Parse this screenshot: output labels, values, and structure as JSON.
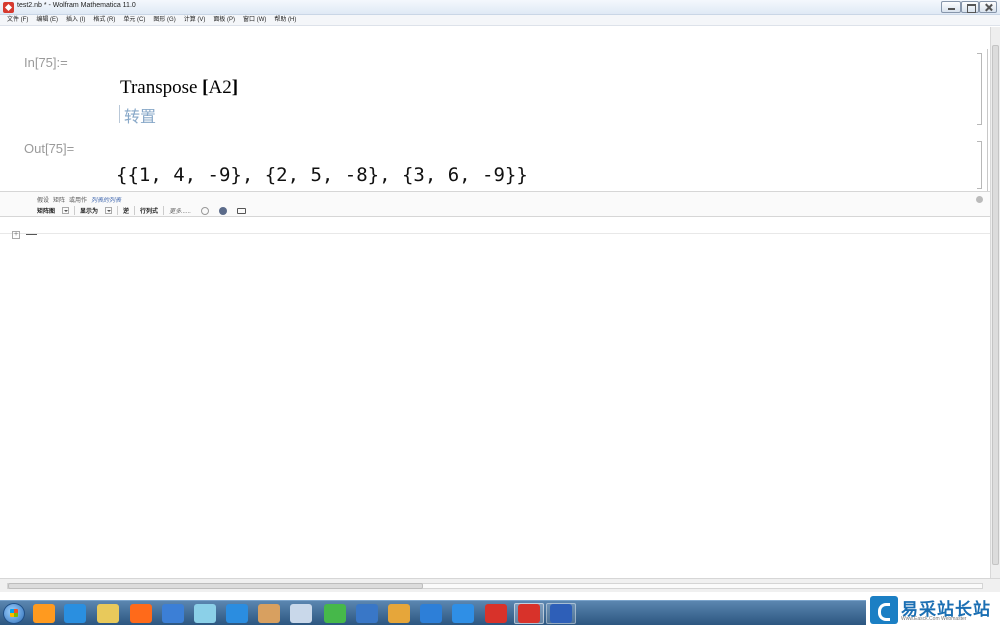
{
  "window": {
    "title": "test2.nb * - Wolfram Mathematica 11.0"
  },
  "menu": {
    "items": [
      {
        "label": "文件 (F)"
      },
      {
        "label": "编辑 (E)"
      },
      {
        "label": "插入 (I)"
      },
      {
        "label": "格式 (R)"
      },
      {
        "label": "单元 (C)"
      },
      {
        "label": "图形 (G)"
      },
      {
        "label": "计算 (V)"
      },
      {
        "label": "面板 (P)"
      },
      {
        "label": "窗口 (W)"
      },
      {
        "label": "帮助 (H)"
      }
    ]
  },
  "notebook": {
    "in_label": "In[75]:=",
    "input_fn": "Transpose ",
    "input_open": "[",
    "input_arg": "A2",
    "input_close": "]",
    "input_hint": "转置",
    "out_label": "Out[75]=",
    "output": "{{1, 4, -9}, {2, 5, -8}, {3, 6, -9}}"
  },
  "suggestions": {
    "row1": {
      "preset": "假设",
      "matrix": "矩阵",
      "or": "或用作",
      "list_of_lists": "列表的列表"
    },
    "row2": {
      "matrix_plot": "矩阵图",
      "display_as": "显示为",
      "inverse": "逆",
      "determinant": "行列式",
      "more": "更多......"
    }
  },
  "taskbar": {
    "icon_colors": [
      "#ff9a1f",
      "#2a8fe0",
      "#e8c95b",
      "#ff6a1a",
      "#3c7fd6",
      "#8bd0e8",
      "#2b8de0",
      "#d8a060",
      "#c9d8ea",
      "#46b84a",
      "#3977c7",
      "#e6a63a",
      "#2d7fd8",
      "#2f8fe6",
      "#d8322a",
      "#2e5fb8"
    ]
  },
  "watermark": {
    "text": "易采站长站",
    "subtext": "Www.Easck.Com  Webmaster"
  }
}
